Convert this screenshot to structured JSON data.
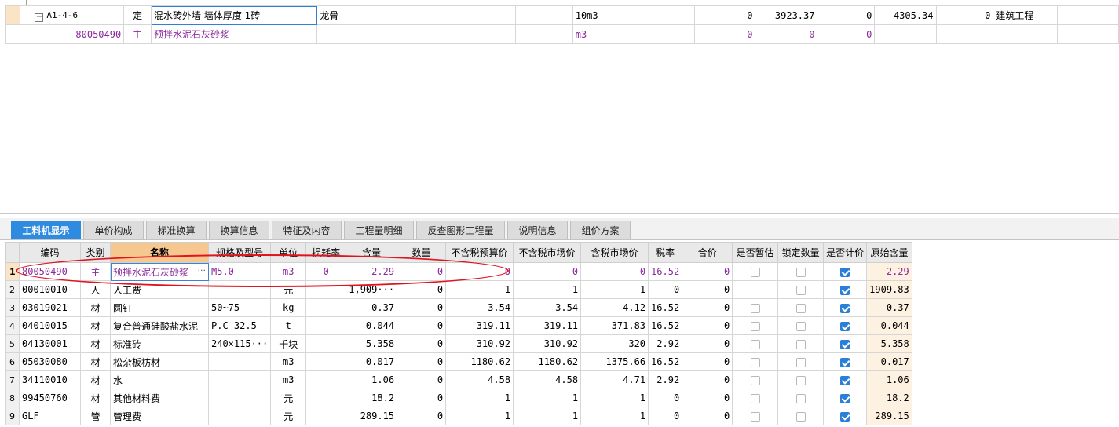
{
  "top_grid": {
    "rows": [
      {
        "code": "A1-4-6",
        "type": "定",
        "name": "混水砖外墙 墙体厚度 1砖",
        "feature": "龙骨",
        "unit": "10m3",
        "v1": "0",
        "v2": "3923.37",
        "v3": "0",
        "v4": "4305.34",
        "v5": "0",
        "profession": "建筑工程",
        "expander": "−"
      },
      {
        "code": "80050490",
        "type": "主",
        "name": "预拌水泥石灰砂浆",
        "feature": "",
        "unit": "m3",
        "v1": "0",
        "v2": "0",
        "v3": "0",
        "v4": "",
        "v5": "",
        "profession": "",
        "expander": ""
      }
    ]
  },
  "tabs": [
    "工料机显示",
    "单价构成",
    "标准换算",
    "换算信息",
    "特征及内容",
    "工程量明细",
    "反查图形工程量",
    "说明信息",
    "组价方案"
  ],
  "bottom_grid": {
    "headers": [
      "编码",
      "类别",
      "名称",
      "规格及型号",
      "单位",
      "损耗率",
      "含量",
      "数量",
      "不含税预算价",
      "不含税市场价",
      "含税市场价",
      "税率",
      "合价",
      "是否暂估",
      "锁定数量",
      "是否计价",
      "原始含量"
    ],
    "ellipsis": "···",
    "rows": [
      {
        "idx": "1",
        "code": "80050490",
        "type": "主",
        "name": "预拌水泥石灰砂浆",
        "spec": "M5.0",
        "unit": "m3",
        "loss": "0",
        "content": "2.29",
        "qty": "0",
        "budget": "0",
        "market": "0",
        "market_tax": "0",
        "tax": "16.52",
        "total": "0",
        "est": false,
        "lock": false,
        "price": true,
        "orig": "2.29"
      },
      {
        "idx": "2",
        "code": "00010010",
        "type": "人",
        "name": "人工费",
        "spec": "",
        "unit": "元",
        "loss": "",
        "content": "1,909···",
        "qty": "0",
        "budget": "1",
        "market": "1",
        "market_tax": "1",
        "tax": "0",
        "total": "0",
        "est": null,
        "lock": false,
        "price": true,
        "orig": "1909.83"
      },
      {
        "idx": "3",
        "code": "03019021",
        "type": "材",
        "name": "圆钉",
        "spec": "50~75",
        "unit": "kg",
        "loss": "",
        "content": "0.37",
        "qty": "0",
        "budget": "3.54",
        "market": "3.54",
        "market_tax": "4.12",
        "tax": "16.52",
        "total": "0",
        "est": false,
        "lock": false,
        "price": true,
        "orig": "0.37"
      },
      {
        "idx": "4",
        "code": "04010015",
        "type": "材",
        "name": "复合普通硅酸盐水泥",
        "spec": "P.C 32.5",
        "unit": "t",
        "loss": "",
        "content": "0.044",
        "qty": "0",
        "budget": "319.11",
        "market": "319.11",
        "market_tax": "371.83",
        "tax": "16.52",
        "total": "0",
        "est": false,
        "lock": false,
        "price": true,
        "orig": "0.044"
      },
      {
        "idx": "5",
        "code": "04130001",
        "type": "材",
        "name": "标准砖",
        "spec": "240×115···",
        "unit": "千块",
        "loss": "",
        "content": "5.358",
        "qty": "0",
        "budget": "310.92",
        "market": "310.92",
        "market_tax": "320",
        "tax": "2.92",
        "total": "0",
        "est": false,
        "lock": false,
        "price": true,
        "orig": "5.358"
      },
      {
        "idx": "6",
        "code": "05030080",
        "type": "材",
        "name": "松杂板枋材",
        "spec": "",
        "unit": "m3",
        "loss": "",
        "content": "0.017",
        "qty": "0",
        "budget": "1180.62",
        "market": "1180.62",
        "market_tax": "1375.66",
        "tax": "16.52",
        "total": "0",
        "est": false,
        "lock": false,
        "price": true,
        "orig": "0.017"
      },
      {
        "idx": "7",
        "code": "34110010",
        "type": "材",
        "name": "水",
        "spec": "",
        "unit": "m3",
        "loss": "",
        "content": "1.06",
        "qty": "0",
        "budget": "4.58",
        "market": "4.58",
        "market_tax": "4.71",
        "tax": "2.92",
        "total": "0",
        "est": false,
        "lock": false,
        "price": true,
        "orig": "1.06"
      },
      {
        "idx": "8",
        "code": "99450760",
        "type": "材",
        "name": "其他材料费",
        "spec": "",
        "unit": "元",
        "loss": "",
        "content": "18.2",
        "qty": "0",
        "budget": "1",
        "market": "1",
        "market_tax": "1",
        "tax": "0",
        "total": "0",
        "est": false,
        "lock": false,
        "price": true,
        "orig": "18.2"
      },
      {
        "idx": "9",
        "code": "GLF",
        "type": "管",
        "name": "管理费",
        "spec": "",
        "unit": "元",
        "loss": "",
        "content": "289.15",
        "qty": "0",
        "budget": "1",
        "market": "1",
        "market_tax": "1",
        "tax": "0",
        "total": "0",
        "est": false,
        "lock": false,
        "price": true,
        "orig": "289.15"
      }
    ]
  },
  "colors": {
    "accent": "#2e8be0",
    "purple_text": "#8b2a9c",
    "annotation": "#e0141e",
    "header_highlight": "#f7c790",
    "row_indicator": "#fbe3c6"
  }
}
